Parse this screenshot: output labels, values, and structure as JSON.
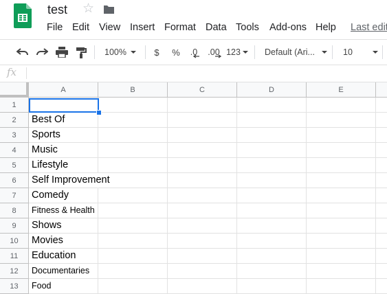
{
  "app": {
    "title": "test",
    "menu": [
      "File",
      "Edit",
      "View",
      "Insert",
      "Format",
      "Data",
      "Tools",
      "Add-ons",
      "Help"
    ],
    "last_edit": "Last edit"
  },
  "toolbar": {
    "zoom": "100%",
    "currency": "$",
    "percent": "%",
    "dec_decrease": ".0",
    "dec_increase": ".00",
    "more_formats": "123",
    "font": "Default (Ari...",
    "font_size": "10"
  },
  "formula_bar": {
    "fx": "fx",
    "value": ""
  },
  "sheet": {
    "columns": [
      "A",
      "B",
      "C",
      "D",
      "E"
    ],
    "rows": [
      {
        "n": "1",
        "a": ""
      },
      {
        "n": "2",
        "a": "Best Of"
      },
      {
        "n": "3",
        "a": "Sports"
      },
      {
        "n": "4",
        "a": "Music"
      },
      {
        "n": "5",
        "a": "Lifestyle"
      },
      {
        "n": "6",
        "a": "Self Improvement"
      },
      {
        "n": "7",
        "a": "Comedy"
      },
      {
        "n": "8",
        "a": "Fitness & Health"
      },
      {
        "n": "9",
        "a": "Shows"
      },
      {
        "n": "10",
        "a": "Movies"
      },
      {
        "n": "11",
        "a": "Education"
      },
      {
        "n": "12",
        "a": "Documentaries"
      },
      {
        "n": "13",
        "a": "Food"
      }
    ]
  },
  "colors": {
    "accent": "#1a73e8",
    "logo": "#0f9d58"
  }
}
